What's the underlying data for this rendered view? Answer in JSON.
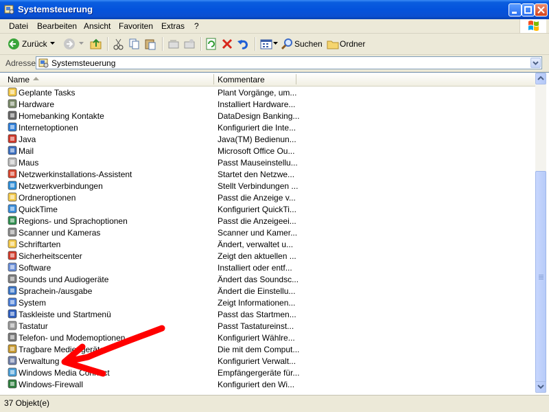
{
  "window": {
    "title": "Systemsteuerung"
  },
  "menu": [
    "Datei",
    "Bearbeiten",
    "Ansicht",
    "Favoriten",
    "Extras",
    "?"
  ],
  "toolbar": {
    "back": "Zurück",
    "search": "Suchen",
    "folders": "Ordner"
  },
  "address": {
    "label": "Adresse",
    "value": "Systemsteuerung"
  },
  "columns": {
    "name": "Name",
    "comments": "Kommentare"
  },
  "items": [
    {
      "name": "Geplante Tasks",
      "comment": "Plant Vorgänge, um...",
      "icon": "scheduled-tasks-icon"
    },
    {
      "name": "Hardware",
      "comment": "Installiert Hardware...",
      "icon": "hardware-icon"
    },
    {
      "name": "Homebanking Kontakte",
      "comment": "DataDesign Banking...",
      "icon": "homebanking-icon"
    },
    {
      "name": "Internetoptionen",
      "comment": "Konfiguriert die Inte...",
      "icon": "internet-options-icon"
    },
    {
      "name": "Java",
      "comment": "Java(TM) Bedienun...",
      "icon": "java-icon"
    },
    {
      "name": "Mail",
      "comment": "Microsoft Office Ou...",
      "icon": "mail-icon"
    },
    {
      "name": "Maus",
      "comment": "Passt Mauseinstellu...",
      "icon": "mouse-icon"
    },
    {
      "name": "Netzwerkinstallations-Assistent",
      "comment": "Startet den Netzwe...",
      "icon": "network-wizard-icon"
    },
    {
      "name": "Netzwerkverbindungen",
      "comment": "Stellt Verbindungen ...",
      "icon": "network-connections-icon"
    },
    {
      "name": "Ordneroptionen",
      "comment": "Passt die Anzeige v...",
      "icon": "folder-options-icon"
    },
    {
      "name": "QuickTime",
      "comment": "Konfiguriert QuickTi...",
      "icon": "quicktime-icon"
    },
    {
      "name": "Regions- und Sprachoptionen",
      "comment": "Passt die Anzeigeei...",
      "icon": "regional-options-icon"
    },
    {
      "name": "Scanner und Kameras",
      "comment": "Scanner und Kamer...",
      "icon": "scanner-icon"
    },
    {
      "name": "Schriftarten",
      "comment": "Ändert, verwaltet u...",
      "icon": "fonts-icon"
    },
    {
      "name": "Sicherheitscenter",
      "comment": "Zeigt den aktuellen ...",
      "icon": "security-center-icon"
    },
    {
      "name": "Software",
      "comment": "Installiert oder entf...",
      "icon": "software-icon"
    },
    {
      "name": "Sounds und Audiogeräte",
      "comment": "Ändert das Soundsc...",
      "icon": "sounds-icon"
    },
    {
      "name": "Sprachein-/ausgabe",
      "comment": "Ändert die Einstellu...",
      "icon": "speech-icon"
    },
    {
      "name": "System",
      "comment": "Zeigt Informationen...",
      "icon": "system-icon"
    },
    {
      "name": "Taskleiste und Startmenü",
      "comment": "Passt das Startmen...",
      "icon": "taskbar-icon"
    },
    {
      "name": "Tastatur",
      "comment": "Passt Tastatureinst...",
      "icon": "keyboard-icon"
    },
    {
      "name": "Telefon- und Modemoptionen",
      "comment": "Konfiguriert Wählre...",
      "icon": "phone-modem-icon"
    },
    {
      "name": "Tragbare Mediengeräte",
      "comment": "Die mit dem Comput...",
      "icon": "portable-media-icon"
    },
    {
      "name": "Verwaltung",
      "comment": "Konfiguriert Verwalt...",
      "icon": "admin-tools-icon"
    },
    {
      "name": "Windows Media Connect",
      "comment": "Empfängergeräte für...",
      "icon": "media-connect-icon"
    },
    {
      "name": "Windows-Firewall",
      "comment": "Konfiguriert den Wi...",
      "icon": "firewall-icon"
    }
  ],
  "status": {
    "text": "37 Objekt(e)"
  },
  "colors": {
    "titlebar": "#0453dc",
    "chrome": "#ece9d8",
    "annotation": "#ff0000"
  }
}
